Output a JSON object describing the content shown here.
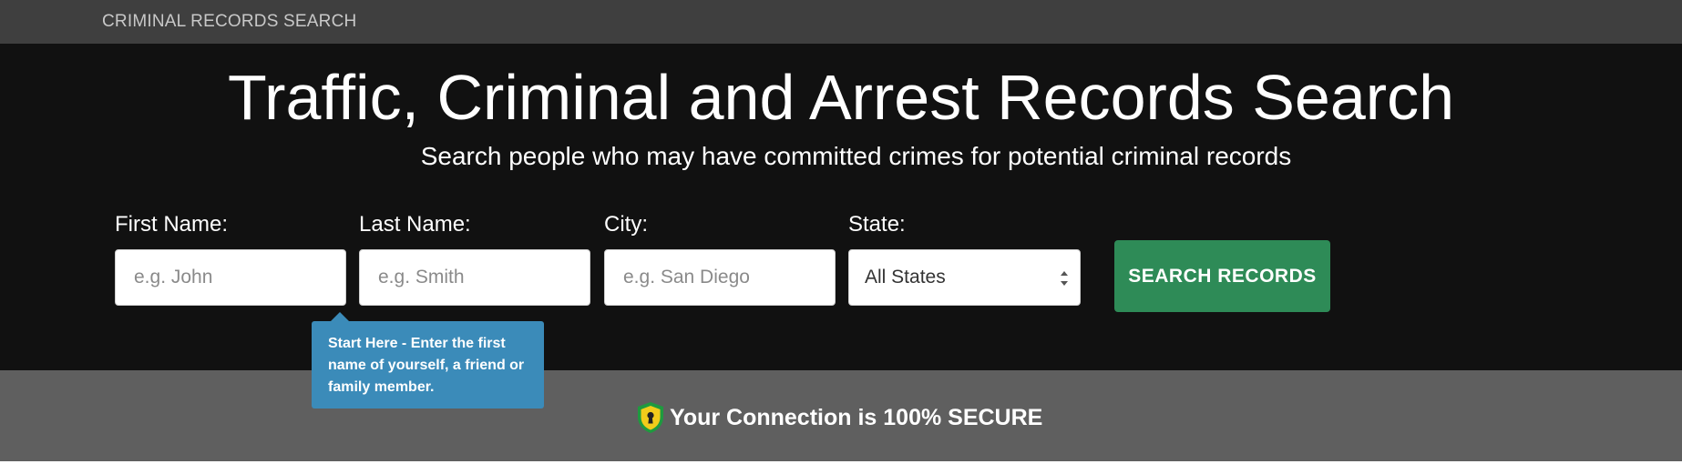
{
  "header": {
    "brand": "CRIMINAL RECORDS SEARCH"
  },
  "hero": {
    "title": "Traffic, Criminal and Arrest Records Search",
    "subtitle": "Search people who may have committed crimes for potential criminal records"
  },
  "form": {
    "first_name": {
      "label": "First Name:",
      "placeholder": "e.g. John",
      "value": ""
    },
    "last_name": {
      "label": "Last Name:",
      "placeholder": "e.g. Smith",
      "value": ""
    },
    "city": {
      "label": "City:",
      "placeholder": "e.g. San Diego",
      "value": ""
    },
    "state": {
      "label": "State:",
      "selected": "All States"
    },
    "submit_label": "SEARCH RECORDS"
  },
  "tooltip": {
    "text": "Start Here - Enter the first name of yourself, a friend or family member."
  },
  "security": {
    "text": "Your Connection is 100% SECURE",
    "icon": "shield-lock-icon"
  },
  "colors": {
    "topbar": "#3f3f3f",
    "hero_background": "#111111",
    "button": "#2e8b57",
    "tooltip": "#3b8bb9",
    "secure_bar": "#5f5f5f",
    "shield_yellow": "#f2cc1b",
    "shield_green": "#1f9a3f"
  }
}
